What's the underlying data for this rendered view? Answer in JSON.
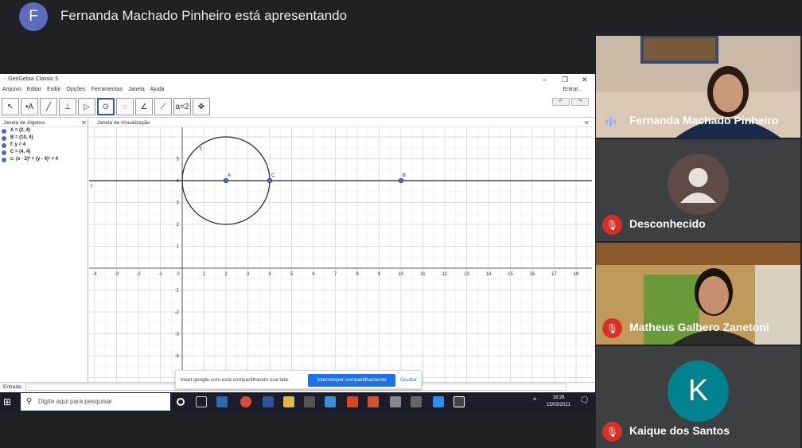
{
  "header": {
    "avatar_letter": "F",
    "presenting": "Fernanda Machado Pinheiro está apresentando"
  },
  "geogebra": {
    "title": "GeoGebra Classic 5",
    "menu": [
      "Arquivo",
      "Editar",
      "Exibir",
      "Opções",
      "Ferramentas",
      "Janela",
      "Ajuda"
    ],
    "login": "Entrar...",
    "algebra_title": "Janela de Álgebra",
    "view_title": "Janela de Visualização",
    "algebra_items": [
      "A = (2, 4)",
      "B = (10, 4)",
      "f: y = 4",
      "C = (4, 4)",
      "c: (x - 2)² + (y - 4)² = 4"
    ],
    "input_label": "Entrada",
    "circle_label": "c",
    "line_label": "f",
    "point_labels": [
      "A",
      "B",
      "C"
    ],
    "x_ticks": [
      "-4",
      "-3",
      "-2",
      "-1",
      "0",
      "1",
      "2",
      "3",
      "4",
      "5",
      "6",
      "7",
      "8",
      "9",
      "10",
      "11",
      "12",
      "13",
      "14",
      "15",
      "16",
      "17",
      "18"
    ],
    "y_ticks": [
      "5",
      "4",
      "3",
      "2",
      "1",
      "-1",
      "-2",
      "-3",
      "-4"
    ]
  },
  "share_banner": {
    "message": "meet.google.com está compartilhando sua tela.",
    "stop": "Interromper compartilhamento",
    "hide": "Ocultar"
  },
  "taskbar": {
    "search_placeholder": "Digite aqui para pesquisar",
    "time": "19:26",
    "date": "15/03/2021"
  },
  "participants": [
    {
      "name": "Fernanda Machado Pinheiro",
      "muted": false
    },
    {
      "name": "Desconhecido",
      "muted": true
    },
    {
      "name": "Matheus Galbero Zanetoni",
      "muted": true
    },
    {
      "name": "Kaique dos Santos",
      "muted": true,
      "letter": "K"
    }
  ],
  "colors": {
    "mic_off": "#d93025",
    "avatar_k": "#00838f",
    "accent_blue": "#1a73e8"
  }
}
